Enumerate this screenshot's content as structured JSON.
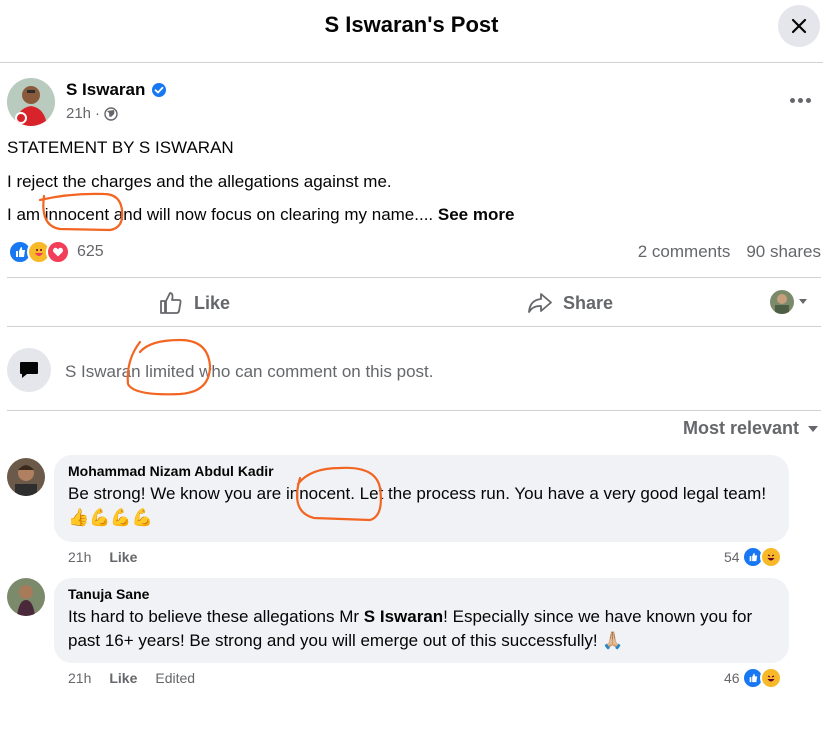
{
  "header": {
    "title": "S Iswaran's Post",
    "close_icon": "close-icon"
  },
  "post": {
    "author": "S Iswaran",
    "verified_icon": "verified-badge-icon",
    "time": "21h",
    "visibility_icon": "globe-icon",
    "line1": "STATEMENT BY S ISWARAN",
    "line2": "I reject the charges and the allegations against me.",
    "line3": "I am innocent and will now focus on clearing my name....",
    "see_more": "See more",
    "reaction_count": "625",
    "comments": "2 comments",
    "shares": "90 shares"
  },
  "actions": {
    "like": "Like",
    "share": "Share"
  },
  "limited_notice": "S Iswaran limited who can comment on this post.",
  "sort_label": "Most relevant",
  "comments": [
    {
      "name": "Mohammad Nizam Abdul Kadir",
      "text": "Be strong! We know you are innocent. Let the process run. You have a very good legal team! 👍💪💪💪",
      "time": "21h",
      "like": "Like",
      "reactions": "54"
    },
    {
      "name": "Tanuja Sane",
      "text_before": "Its hard to believe these allegations Mr ",
      "mention": "S Iswaran",
      "text_after": "! Especially since we have known you for past 16+ years! Be strong and you will emerge out of this successfully! 🙏🏼",
      "time": "21h",
      "like": "Like",
      "edited": "Edited",
      "reactions": "46"
    }
  ],
  "colors": {
    "accent": "#1877f2",
    "annotation": "#f26522",
    "muted": "#65676b"
  }
}
